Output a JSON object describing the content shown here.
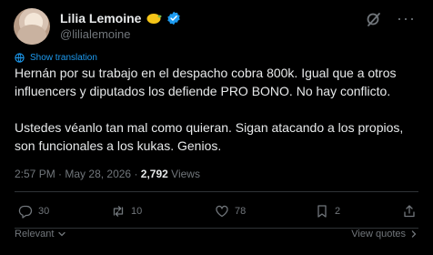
{
  "author": {
    "name": "Lilia Lemoine",
    "handle": "@lilialemoine",
    "emoji": "lemon-icon",
    "verified_icon": "verified-badge-icon"
  },
  "translate": {
    "label": "Show translation"
  },
  "tweet": {
    "paragraphs": [
      "Hernán por su trabajo en el despacho cobra 800k. Igual que a otros influencers y diputados los defiende PRO BONO. No hay conflicto.",
      "Ustedes véanlo tan mal como quieran. Sigan atacando a los propios, son funcionales a los kukas. Genios."
    ]
  },
  "meta": {
    "time": "2:57 PM",
    "date": "May 28, 2026",
    "views_count": "2,792",
    "views_label": "Views",
    "separator": "·"
  },
  "actions": {
    "replies": "30",
    "reposts": "10",
    "likes": "78",
    "bookmarks": "2"
  },
  "footer": {
    "sort_label": "Relevant",
    "quotes_label": "View quotes"
  },
  "colors": {
    "background": "#000000",
    "text": "#e7e9ea",
    "muted": "#71767b",
    "accent": "#1d9bf0",
    "divider": "#2f3336"
  }
}
